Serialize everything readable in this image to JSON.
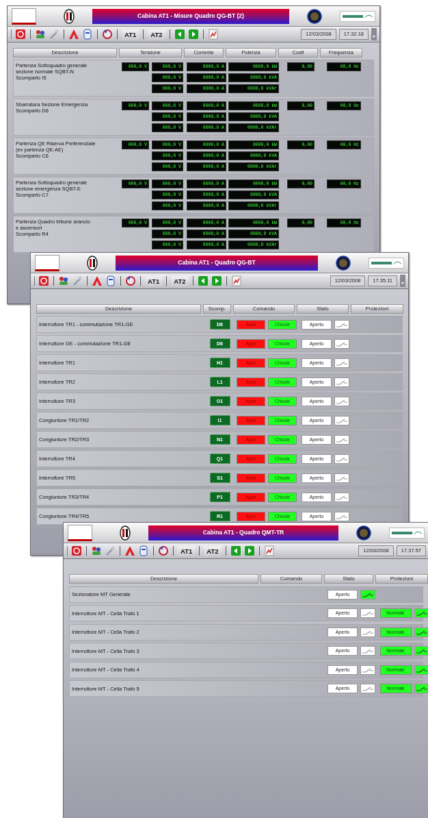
{
  "windows": [
    {
      "kind": "measures",
      "title": "Cabina AT1 - Misure Quadro QG-BT (2)",
      "toolbar_buttons": [
        "AT1",
        "AT2"
      ],
      "date": "12/03/2008",
      "time": "17.32.18",
      "columns": [
        "Descrizione",
        "Tensione",
        "Corrente",
        "Potenza",
        "Cosfi",
        "Frequenza"
      ],
      "rows": [
        {
          "description": [
            "Partenza Sottoquadro generale",
            "sezione normale SQBT-N",
            "Scomparto I5"
          ],
          "voltage_main": "000,0 V",
          "voltages": [
            "000,0 V",
            "000,0 V",
            "000,0 V"
          ],
          "currents": [
            "0000,0 A",
            "0000,0 A",
            "0000,0 A"
          ],
          "powers": [
            "0000,0 kW",
            "0000,0 kVA",
            "0000,0 kVAr"
          ],
          "cosfi": "0,00",
          "frequency": "00,0 Hz"
        },
        {
          "description": [
            "Sbarratura Sezione Emergenza",
            "Scomparto D6"
          ],
          "voltage_main": "000,0 V",
          "voltages": [
            "000,0 V",
            "000,0 V",
            "000,0 V"
          ],
          "currents": [
            "0000,0 A",
            "0000,0 A",
            "0000,0 A"
          ],
          "powers": [
            "0000,0 kW",
            "0000,0 kVA",
            "0000,0 kVAr"
          ],
          "cosfi": "0,00",
          "frequency": "00,0 Hz"
        },
        {
          "description": [
            "Partenza QE Riserva Preferenziale",
            "(ex partenza QE-AE)",
            "Scomparto C6"
          ],
          "voltage_main": "000,0 V",
          "voltages": [
            "000,0 V",
            "000,0 V",
            "000,0 V"
          ],
          "currents": [
            "0000,0 A",
            "0000,0 A",
            "0000,0 A"
          ],
          "powers": [
            "0000,0 kW",
            "0000,0 kVA",
            "0000,0 kVAr"
          ],
          "cosfi": "0,00",
          "frequency": "00,0 Hz"
        },
        {
          "description": [
            "Partenza Sottoquadro generale",
            "sezione emergenza SQBT-E",
            "Scomparto C7"
          ],
          "voltage_main": "000,0 V",
          "voltages": [
            "000,0 V",
            "000,0 V",
            "000,0 V"
          ],
          "currents": [
            "0000,0 A",
            "0000,0 A",
            "0000,0 A"
          ],
          "powers": [
            "0000,0 kW",
            "0000,0 kVA",
            "0000,0 kVAr"
          ],
          "cosfi": "0,00",
          "frequency": "00,0 Hz"
        },
        {
          "description": [
            "Partenza Quadro tribune arancio",
            "e ascensori",
            "Scomparto R4"
          ],
          "voltage_main": "000,0 V",
          "voltages": [
            "000,0 V",
            "000,0 V",
            "000,0 V"
          ],
          "currents": [
            "0000,0 A",
            "0000,0 A",
            "0000,0 A"
          ],
          "powers": [
            "0000,0 kW",
            "0000,0 kVA",
            "0000,0 kVAr"
          ],
          "cosfi": "0,00",
          "frequency": "00,0 Hz"
        }
      ]
    },
    {
      "kind": "switchgear",
      "title": "Cabina AT1 - Quadro QG-BT",
      "toolbar_buttons": [
        "AT1",
        "AT2"
      ],
      "date": "12/03/2008",
      "time": "17.35.11",
      "columns": [
        "Descrizione",
        "Scomp.",
        "Comando",
        "Stato",
        "Protezioni"
      ],
      "rows": [
        {
          "description": "Interruttore TR1 - commutazione TR1-GE",
          "compartment": "D6",
          "commands": [
            {
              "label": "Apre",
              "kind": "open"
            },
            {
              "label": "Chiude",
              "kind": "close"
            }
          ],
          "state": "Aperto",
          "indicator_on": false
        },
        {
          "description": "Interruttore GE - commutazione TR1-GE",
          "compartment": "D6",
          "commands": [
            {
              "label": "Apre",
              "kind": "open"
            },
            {
              "label": "Chiude",
              "kind": "close"
            }
          ],
          "state": "Aperto",
          "indicator_on": false
        },
        {
          "description": "Interruttore TR1",
          "compartment": "H1",
          "commands": [
            {
              "label": "Apre",
              "kind": "open"
            },
            {
              "label": "Chiude",
              "kind": "close"
            }
          ],
          "state": "Aperto",
          "indicator_on": false
        },
        {
          "description": "Interruttore TR2",
          "compartment": "L1",
          "commands": [
            {
              "label": "Apre",
              "kind": "open"
            },
            {
              "label": "Chiude",
              "kind": "close"
            }
          ],
          "state": "Aperto",
          "indicator_on": false
        },
        {
          "description": "Interruttore TR3",
          "compartment": "O1",
          "commands": [
            {
              "label": "Apre",
              "kind": "open"
            },
            {
              "label": "Chiude",
              "kind": "close"
            }
          ],
          "state": "Aperto",
          "indicator_on": false
        },
        {
          "description": "Congiuntore TR1/TR2",
          "compartment": "I1",
          "commands": [
            {
              "label": "Apre",
              "kind": "open"
            },
            {
              "label": "Chiude",
              "kind": "close"
            }
          ],
          "state": "Aperto",
          "indicator_on": false
        },
        {
          "description": "Congiuntore TR2/TR3",
          "compartment": "N1",
          "commands": [
            {
              "label": "Apre",
              "kind": "open"
            },
            {
              "label": "Chiude",
              "kind": "close"
            }
          ],
          "state": "Aperto",
          "indicator_on": false
        },
        {
          "description": "Interruttore TR4",
          "compartment": "Q1",
          "commands": [
            {
              "label": "Apre",
              "kind": "open"
            },
            {
              "label": "Chiude",
              "kind": "close"
            }
          ],
          "state": "Aperto",
          "indicator_on": false
        },
        {
          "description": "Interruttore TR5",
          "compartment": "S1",
          "commands": [
            {
              "label": "Apre",
              "kind": "open"
            },
            {
              "label": "Chiude",
              "kind": "close"
            }
          ],
          "state": "Aperto",
          "indicator_on": false
        },
        {
          "description": "Congiuntore TR3/TR4",
          "compartment": "P1",
          "commands": [
            {
              "label": "Apre",
              "kind": "open"
            },
            {
              "label": "Chiude",
              "kind": "close"
            }
          ],
          "state": "Aperto",
          "indicator_on": false
        },
        {
          "description": "Congiuntore TR4/TR5",
          "compartment": "R1",
          "commands": [
            {
              "label": "Apre",
              "kind": "open"
            },
            {
              "label": "Chiude",
              "kind": "close"
            }
          ],
          "state": "Aperto",
          "indicator_on": false
        }
      ]
    },
    {
      "kind": "switchgear",
      "title": "Cabina AT1 - Quadro QMT-TR",
      "toolbar_buttons": [
        "AT1",
        "AT2"
      ],
      "date": "12/03/2008",
      "time": "17.37.57",
      "columns": [
        "Descrizione",
        "Comando",
        "Stato",
        "Protezioni"
      ],
      "rows": [
        {
          "description": "Sezionatore MT Generale",
          "state": "Aperto",
          "indicator_on": true
        },
        {
          "description": "Interruttore MT - Cella Trafo 1",
          "state": "Aperto",
          "indicator_on": false,
          "protection": {
            "label": "Normale",
            "indicator_on": true
          }
        },
        {
          "description": "Interruttore MT - Cella Trafo 2",
          "state": "Aperto",
          "indicator_on": false,
          "protection": {
            "label": "Normale",
            "indicator_on": true
          }
        },
        {
          "description": "Interruttore MT - Cella Trafo 3",
          "state": "Aperto",
          "indicator_on": false,
          "protection": {
            "label": "Normale",
            "indicator_on": true
          }
        },
        {
          "description": "Interruttore MT - Cella Trafo 4",
          "state": "Aperto",
          "indicator_on": false,
          "protection": {
            "label": "Normale",
            "indicator_on": true
          }
        },
        {
          "description": "Interruttore MT - Cella Trafo 5",
          "state": "Aperto",
          "indicator_on": false,
          "protection": {
            "label": "Normale",
            "indicator_on": true
          }
        }
      ]
    }
  ]
}
